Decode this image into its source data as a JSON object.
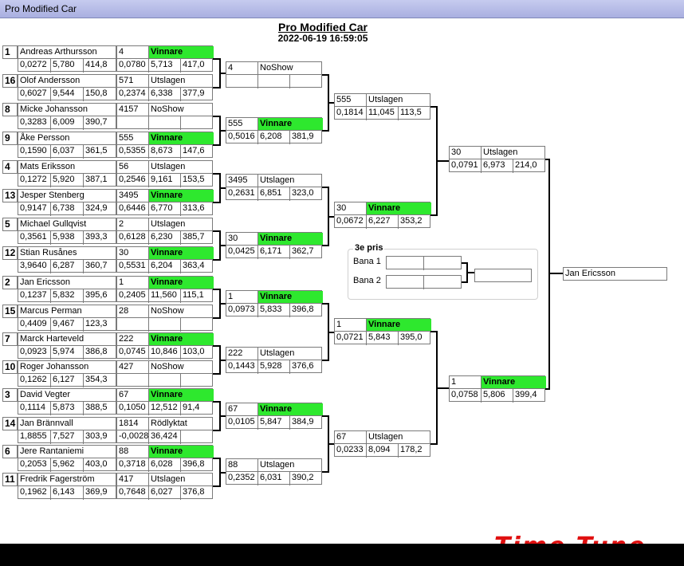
{
  "window": {
    "title": "Pro Modified Car"
  },
  "header": {
    "event": "Pro Modified Car",
    "datetime": "2022-06-19 16:59:05"
  },
  "win_color": "#2ee82e",
  "logo": {
    "text": "Time Tune",
    "color": "#e01010"
  },
  "round1": [
    {
      "seed": "1",
      "name": "Andreas Arthursson",
      "rt": "0,0272",
      "et": "5,780",
      "spd": "414,8",
      "car": "4",
      "res": "Vinnare",
      "rt2": "0,0780",
      "et2": "5,713",
      "spd2": "417,0"
    },
    {
      "seed": "16",
      "name": "Olof Andersson",
      "rt": "0,6027",
      "et": "9,544",
      "spd": "150,8",
      "car": "571",
      "res": "Utslagen",
      "rt2": "0,2374",
      "et2": "6,338",
      "spd2": "377,9"
    },
    {
      "seed": "8",
      "name": "Micke Johansson",
      "rt": "0,3283",
      "et": "6,009",
      "spd": "390,7",
      "car": "4157",
      "res": "NoShow",
      "rt2": "",
      "et2": "",
      "spd2": ""
    },
    {
      "seed": "9",
      "name": "Åke Persson",
      "rt": "0,1590",
      "et": "6,037",
      "spd": "361,5",
      "car": "555",
      "res": "Vinnare",
      "rt2": "0,5355",
      "et2": "8,673",
      "spd2": "147,6"
    },
    {
      "seed": "4",
      "name": "Mats Eriksson",
      "rt": "0,1272",
      "et": "5,920",
      "spd": "387,1",
      "car": "56",
      "res": "Utslagen",
      "rt2": "0,2546",
      "et2": "9,161",
      "spd2": "153,5"
    },
    {
      "seed": "13",
      "name": "Jesper Stenberg",
      "rt": "0,9147",
      "et": "6,738",
      "spd": "324,9",
      "car": "3495",
      "res": "Vinnare",
      "rt2": "0,6446",
      "et2": "6,770",
      "spd2": "313,6"
    },
    {
      "seed": "5",
      "name": "Michael Gullqvist",
      "rt": "0,3561",
      "et": "5,938",
      "spd": "393,3",
      "car": "2",
      "res": "Utslagen",
      "rt2": "0,6128",
      "et2": "6,230",
      "spd2": "385,7"
    },
    {
      "seed": "12",
      "name": "Stian Rusånes",
      "rt": "3,9640",
      "et": "6,287",
      "spd": "360,7",
      "car": "30",
      "res": "Vinnare",
      "rt2": "0,5531",
      "et2": "6,204",
      "spd2": "363,4"
    },
    {
      "seed": "2",
      "name": "Jan Ericsson",
      "rt": "0,1237",
      "et": "5,832",
      "spd": "395,6",
      "car": "1",
      "res": "Vinnare",
      "rt2": "0,2405",
      "et2": "11,560",
      "spd2": "115,1"
    },
    {
      "seed": "15",
      "name": "Marcus Perman",
      "rt": "0,4409",
      "et": "9,467",
      "spd": "123,3",
      "car": "28",
      "res": "NoShow",
      "rt2": "",
      "et2": "",
      "spd2": ""
    },
    {
      "seed": "7",
      "name": "Marck Harteveld",
      "rt": "0,0923",
      "et": "5,974",
      "spd": "386,8",
      "car": "222",
      "res": "Vinnare",
      "rt2": "0,0745",
      "et2": "10,846",
      "spd2": "103,0"
    },
    {
      "seed": "10",
      "name": "Roger Johansson",
      "rt": "0,1262",
      "et": "6,127",
      "spd": "354,3",
      "car": "427",
      "res": "NoShow",
      "rt2": "",
      "et2": "",
      "spd2": ""
    },
    {
      "seed": "3",
      "name": "David Vegter",
      "rt": "0,1114",
      "et": "5,873",
      "spd": "388,5",
      "car": "67",
      "res": "Vinnare",
      "rt2": "0,1050",
      "et2": "12,512",
      "spd2": "91,4"
    },
    {
      "seed": "14",
      "name": "Jan Brännvall",
      "rt": "1,8855",
      "et": "7,527",
      "spd": "303,9",
      "car": "1814",
      "res": "Rödlyktat",
      "rt2": "-0,0028",
      "et2": "36,424",
      "spd2": ""
    },
    {
      "seed": "6",
      "name": "Jere Rantaniemi",
      "rt": "0,2053",
      "et": "5,962",
      "spd": "403,0",
      "car": "88",
      "res": "Vinnare",
      "rt2": "0,3718",
      "et2": "6,028",
      "spd2": "396,8"
    },
    {
      "seed": "11",
      "name": "Fredrik Fagerström",
      "rt": "0,1962",
      "et": "6,143",
      "spd": "369,9",
      "car": "417",
      "res": "Utslagen",
      "rt2": "0,7648",
      "et2": "6,027",
      "spd2": "376,8"
    }
  ],
  "round2": [
    {
      "car": "4",
      "res": "NoShow",
      "rt": "",
      "et": "",
      "spd": ""
    },
    {
      "car": "555",
      "res": "Vinnare",
      "rt": "0,5016",
      "et": "6,208",
      "spd": "381,9"
    },
    {
      "car": "3495",
      "res": "Utslagen",
      "rt": "0,2631",
      "et": "6,851",
      "spd": "323,0"
    },
    {
      "car": "30",
      "res": "Vinnare",
      "rt": "0,0425",
      "et": "6,171",
      "spd": "362,7"
    },
    {
      "car": "1",
      "res": "Vinnare",
      "rt": "0,0973",
      "et": "5,833",
      "spd": "396,8"
    },
    {
      "car": "222",
      "res": "Utslagen",
      "rt": "0,1443",
      "et": "5,928",
      "spd": "376,6"
    },
    {
      "car": "67",
      "res": "Vinnare",
      "rt": "0,0105",
      "et": "5,847",
      "spd": "384,9"
    },
    {
      "car": "88",
      "res": "Utslagen",
      "rt": "0,2352",
      "et": "6,031",
      "spd": "390,2"
    }
  ],
  "round3": [
    {
      "car": "555",
      "res": "Utslagen",
      "rt": "0,1814",
      "et": "11,045",
      "spd": "113,5"
    },
    {
      "car": "30",
      "res": "Vinnare",
      "rt": "0,0672",
      "et": "6,227",
      "spd": "353,2"
    },
    {
      "car": "1",
      "res": "Vinnare",
      "rt": "0,0721",
      "et": "5,843",
      "spd": "395,0"
    },
    {
      "car": "67",
      "res": "Utslagen",
      "rt": "0,0233",
      "et": "8,094",
      "spd": "178,2"
    }
  ],
  "round4": [
    {
      "car": "30",
      "res": "Utslagen",
      "rt": "0,0791",
      "et": "6,973",
      "spd": "214,0"
    },
    {
      "car": "1",
      "res": "Vinnare",
      "rt": "0,0758",
      "et": "5,806",
      "spd": "399,4"
    }
  ],
  "final": {
    "winner": "Jan Ericsson"
  },
  "third_place": {
    "title": "3e pris",
    "lane1_label": "Bana 1",
    "lane2_label": "Bana 2",
    "lane1_value": "",
    "lane2_value": "",
    "result": ""
  }
}
